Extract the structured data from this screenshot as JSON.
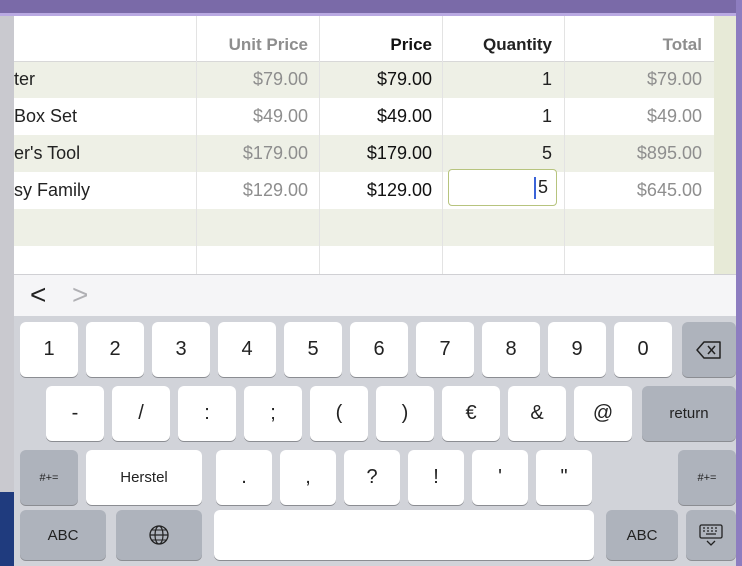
{
  "table": {
    "headers": {
      "unit_price": "Unit Price",
      "price": "Price",
      "quantity": "Quantity",
      "total": "Total"
    },
    "rows": [
      {
        "name": "ter",
        "unit_price": "$79.00",
        "price": "$79.00",
        "quantity": "1",
        "total": "$79.00"
      },
      {
        "name": "Box Set",
        "unit_price": "$49.00",
        "price": "$49.00",
        "quantity": "1",
        "total": "$49.00"
      },
      {
        "name": "er's Tool",
        "unit_price": "$179.00",
        "price": "$179.00",
        "quantity": "5",
        "total": "$895.00"
      },
      {
        "name": "sy Family",
        "unit_price": "$129.00",
        "price": "$129.00",
        "quantity": "5",
        "total": "$645.00"
      }
    ]
  },
  "accessory": {
    "prev": "<",
    "next": ">"
  },
  "keyboard": {
    "row1": [
      "1",
      "2",
      "3",
      "4",
      "5",
      "6",
      "7",
      "8",
      "9",
      "0"
    ],
    "row2": [
      "-",
      "/",
      ":",
      ";",
      "(",
      ")",
      "€",
      "&",
      "@"
    ],
    "return_label": "return",
    "row3": [
      ".",
      ",",
      "?",
      "!",
      "'",
      "\""
    ],
    "symbols_label": "#+=",
    "undo_label": "Herstel",
    "abc_label": "ABC"
  },
  "colors": {
    "selection_border": "#b7c47e",
    "caret": "#3a63d8",
    "shaded_row": "#eef0e6"
  }
}
